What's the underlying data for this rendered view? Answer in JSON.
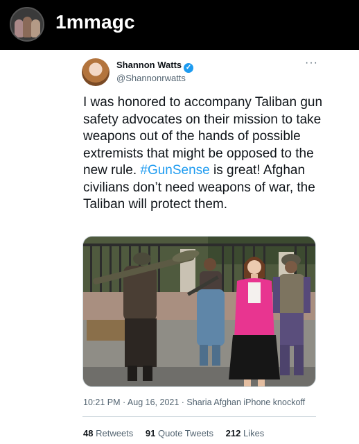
{
  "instagram": {
    "username": "1mmagc",
    "avatar_icon": "profile-photo-avatar"
  },
  "tweet": {
    "author_name": "Shannon Watts",
    "verified_icon": "verified-badge-icon",
    "verified_glyph": "✓",
    "handle": "@Shannonrwatts",
    "more_glyph": "···",
    "text_before_hashtag": "I was honored to accompany Taliban gun safety advocates on their mission to take weapons out of the hands of possible extremists that might be opposed to the new rule. ",
    "hashtag": "#GunSense",
    "text_after_hashtag": " is great! Afghan civilians don’t need weapons of war, the Taliban will protect them.",
    "meta": "10:21 PM · Aug 16, 2021 · Sharia Afghan iPhone knockoff",
    "stats": {
      "retweets_count": "48",
      "retweets_label": "Retweets",
      "quote_tweets_count": "91",
      "quote_tweets_label": "Quote Tweets",
      "likes_count": "212",
      "likes_label": "Likes"
    }
  },
  "colors": {
    "accent": "#1d9bf0",
    "text_primary": "#0f1419",
    "text_secondary": "#536471"
  }
}
